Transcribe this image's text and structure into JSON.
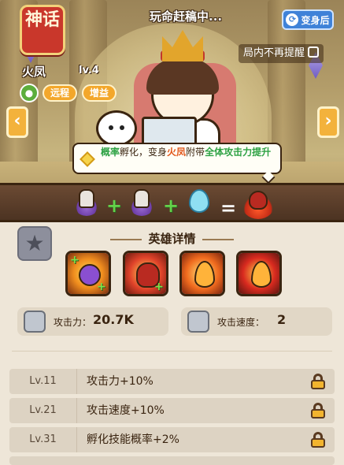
{
  "hero": {
    "badge": "神话",
    "name": "火凤",
    "level": "lv.4",
    "tags": [
      "远程",
      "增益"
    ]
  },
  "header": {
    "title": "玩命赶稿中...",
    "transform_label": "变身后",
    "no_remind_label": "局内不再提醒"
  },
  "tooltip": {
    "part1": "概率",
    "part2": "孵化，变身",
    "part3": "火凤",
    "part4": "附带",
    "part5": "全体攻击力提升"
  },
  "formula": {
    "equals": "="
  },
  "details": {
    "title": "英雄详情",
    "skills": [
      "paw-skill",
      "bat-skill",
      "flame-skill",
      "fire-swirl-skill"
    ],
    "stats": [
      {
        "label": "攻击力：",
        "value": "20.7K"
      },
      {
        "label": "攻击速度：",
        "value": "2"
      }
    ],
    "levels": [
      {
        "lv": "Lv.11",
        "desc": "攻击力+10%"
      },
      {
        "lv": "Lv.21",
        "desc": "攻击速度+10%"
      },
      {
        "lv": "Lv.31",
        "desc": "孵化技能概率+2%"
      }
    ]
  },
  "colors": {
    "accent_orange": "#f3a72b",
    "highlight_green": "#2ea244",
    "highlight_orange": "#e2571b",
    "badge_red": "#c9372b"
  }
}
